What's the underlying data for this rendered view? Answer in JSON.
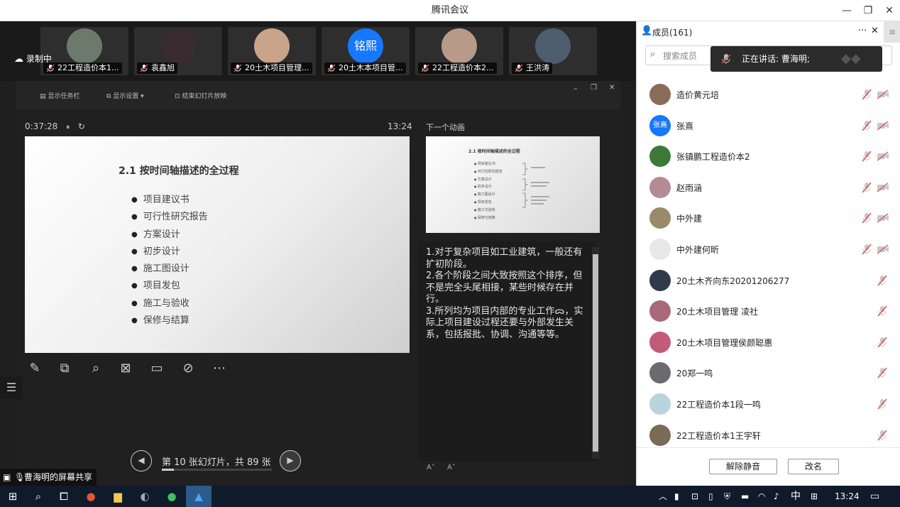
{
  "window": {
    "title": "腾讯会议",
    "min": "—",
    "restore": "❐",
    "close": "✕"
  },
  "recording": {
    "label": "录制中"
  },
  "video_tiles": [
    {
      "name": "22工程造价本1...",
      "avatar_color": "#6b7a6b"
    },
    {
      "name": "袁鑫旭",
      "avatar_color": "#3a2b30"
    },
    {
      "name": "20土木项目管理...",
      "avatar_color": "#c9a48a"
    },
    {
      "name": "20土木本项目管...",
      "avatar_color": "#1677ff",
      "avatar_text": "铭熙"
    },
    {
      "name": "22工程造价本2...",
      "avatar_color": "#b79a88"
    },
    {
      "name": "王洪涛",
      "avatar_color": "#4d5d6e"
    }
  ],
  "ppt_toolbar": {
    "taskbar": "显示任务栏",
    "display": "显示设置 ▾",
    "end": "结束幻灯片放映"
  },
  "presenter": {
    "elapsed": "0:37:28",
    "pause": "⏸",
    "reset": "↻",
    "clock": "13:24",
    "next_label": "下一个动画"
  },
  "slide": {
    "title": "2.1  按时间轴描述的全过程",
    "items": [
      "项目建议书",
      "可行性研究报告",
      "方案设计",
      "初步设计",
      "施工图设计",
      "项目发包",
      "施工与验收",
      "保修与结算"
    ]
  },
  "notes": "1.对于复杂项目如工业建筑，一般还有扩初阶段。\n2.各个阶段之间大致按照这个排序，但不是完全头尾相接，某些时候存在并行。\n3.所列均为项目内部的专业工作ᯅ，实际上项目建设过程还要与外部发生关系，包括报批、协调、沟通等等。",
  "pager": {
    "prev": "◀",
    "next": "▶",
    "text": "第 10 张幻灯片，共 89 张",
    "progress": 0.112
  },
  "font_buttons": {
    "increase": "A˄",
    "decrease": "A˅"
  },
  "share_label": "曹海明的屏幕共享",
  "members_panel": {
    "title": "成员(161)",
    "more": "···",
    "close": "✕",
    "search_placeholder": "搜索成员",
    "speaking": "正在讲话: 曹海明;",
    "members": [
      {
        "name": "造价黄元培",
        "color": "#8a6c5a",
        "cam_off": true
      },
      {
        "name": "张熹",
        "color": "#1677ff",
        "avatar_text": "张熹",
        "cam_off": true
      },
      {
        "name": "张镇鹏工程造价本2",
        "color": "#3d7a3a",
        "cam_off": true
      },
      {
        "name": "赵雨涵",
        "color": "#b58a92",
        "cam_off": true
      },
      {
        "name": "中外建",
        "color": "#9a8a6a",
        "cam_off": true
      },
      {
        "name": "中外建何昕",
        "color": "#e8e8e8",
        "cam_off": true
      },
      {
        "name": "20土木齐向东20201206277",
        "color": "#2f3a4a",
        "cam_off": false
      },
      {
        "name": "20土木项目管理 凌社",
        "color": "#a86a7a",
        "cam_off": false
      },
      {
        "name": "20土木项目管理侯颜聪惠",
        "color": "#c25a7a",
        "cam_off": false
      },
      {
        "name": "20郑一鸣",
        "color": "#6a6a70",
        "cam_off": false
      },
      {
        "name": "22工程造价本1段一鸣",
        "color": "#b8d4dc",
        "cam_off": false
      },
      {
        "name": "22工程造价本1王宇轩",
        "color": "#7a6a58",
        "cam_off": false
      }
    ],
    "unmute_all": "解除静音",
    "rename": "改名"
  },
  "taskbar": {
    "time": "13:24",
    "ime": "中"
  }
}
